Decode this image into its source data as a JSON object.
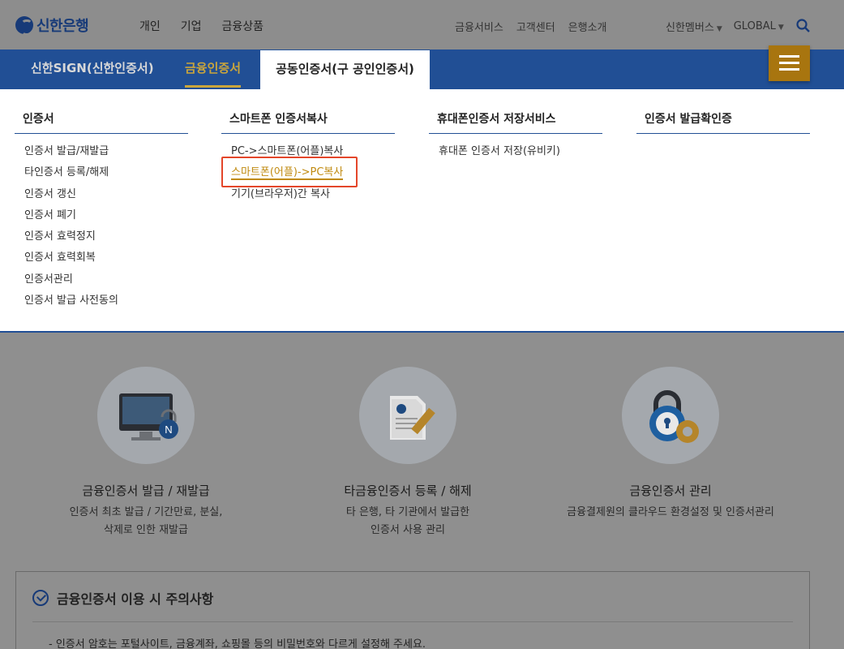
{
  "header": {
    "brand": "신한은행",
    "gnb": [
      "개인",
      "기업",
      "금융상품"
    ],
    "util": [
      "금융서비스",
      "고객센터",
      "은행소개"
    ],
    "util2": [
      "신한멤버스",
      "GLOBAL"
    ]
  },
  "tabs": [
    "신한SIGN(신한인증서)",
    "금융인증서",
    "공동인증서(구 공인인증서)"
  ],
  "menu": [
    {
      "title": "인증서",
      "items": [
        "인증서 발급/재발급",
        "타인증서 등록/해제",
        "인증서 갱신",
        "인증서 폐기",
        "인증서 효력정지",
        "인증서 효력회복",
        "인증서관리",
        "인증서 발급 사전동의"
      ]
    },
    {
      "title": "스마트폰 인증서복사",
      "items": [
        "PC->스마트폰(어플)복사",
        "스마트폰(어플)->PC복사",
        "기기(브라우저)간 복사"
      ]
    },
    {
      "title": "휴대폰인증서 저장서비스",
      "items": [
        "휴대폰 인증서 저장(유비키)"
      ]
    },
    {
      "title": "인증서 발급확인증",
      "items": []
    }
  ],
  "features": [
    {
      "title": "금융인증서 발급 / 재발급",
      "line1": "인증서 최초 발급 / 기간만료, 분실,",
      "line2": "삭제로 인한 재발급"
    },
    {
      "title": "타금융인증서 등록 / 해제",
      "line1": "타 은행, 타 기관에서 발급한",
      "line2": "인증서 사용 관리"
    },
    {
      "title": "금융인증서 관리",
      "line1": "금융결제원의 클라우드 환경설정 및 인증서관리",
      "line2": ""
    }
  ],
  "notice": {
    "title": "금융인증서 이용 시 주의사항",
    "line1": "- 인증서 암호는 포털사이트, 금융계좌, 쇼핑몰 등의 비밀번호와 다르게 설정해 주세요."
  }
}
